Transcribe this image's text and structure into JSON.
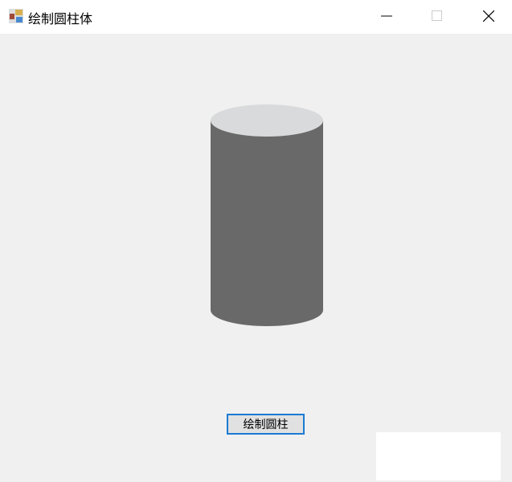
{
  "window": {
    "title": "绘制圆柱体",
    "icon": "app-icon",
    "controls": [
      "minimize-icon",
      "maximize-icon",
      "close-icon"
    ]
  },
  "colors": {
    "cylinder_top": "#d9dadb",
    "cylinder_body": "#696969",
    "button_border": "#1a7ad4"
  },
  "main": {
    "draw_button_label": "绘制圆柱"
  }
}
